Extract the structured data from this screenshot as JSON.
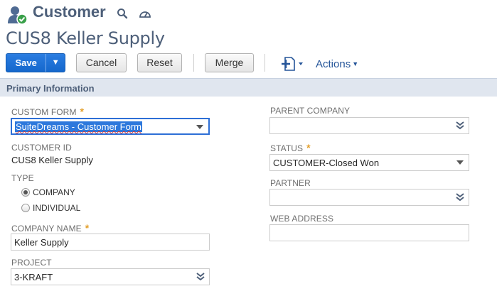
{
  "header": {
    "record_type": "Customer",
    "record_name": "CUS8 Keller Supply",
    "icons": [
      "customer-icon",
      "search-icon",
      "dashboard-icon"
    ]
  },
  "toolbar": {
    "save_label": "Save",
    "cancel_label": "Cancel",
    "reset_label": "Reset",
    "merge_label": "Merge",
    "actions_label": "Actions",
    "icons": [
      "new-record-icon",
      "dropdown-caret-icon"
    ]
  },
  "section": {
    "title": "Primary Information"
  },
  "fields": {
    "custom_form": {
      "label": "CUSTOM FORM",
      "required": "*",
      "value": "SuiteDreams - Customer Form"
    },
    "customer_id": {
      "label": "CUSTOMER ID",
      "value": "CUS8 Keller Supply"
    },
    "type": {
      "label": "TYPE",
      "options": [
        "COMPANY",
        "INDIVIDUAL"
      ],
      "selected": "COMPANY"
    },
    "company_name": {
      "label": "COMPANY NAME",
      "required": "*",
      "value": "Keller Supply"
    },
    "project": {
      "label": "PROJECT",
      "value": "3-KRAFT"
    },
    "parent_company": {
      "label": "PARENT COMPANY",
      "value": ""
    },
    "status": {
      "label": "STATUS",
      "required": "*",
      "value": "CUSTOMER-Closed Won"
    },
    "partner": {
      "label": "PARTNER",
      "value": ""
    },
    "web_address": {
      "label": "WEB ADDRESS",
      "value": ""
    }
  },
  "colors": {
    "accent": "#1467cc",
    "title": "#4d5f79",
    "link": "#255599",
    "required": "#e3a02c",
    "section_bg": "#e0e6ef"
  }
}
